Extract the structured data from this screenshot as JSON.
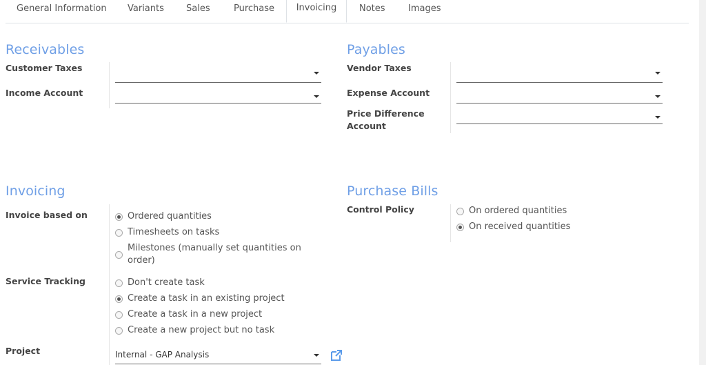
{
  "tabs": [
    {
      "label": "General Information"
    },
    {
      "label": "Variants"
    },
    {
      "label": "Sales"
    },
    {
      "label": "Purchase"
    },
    {
      "label": "Invoicing"
    },
    {
      "label": "Notes"
    },
    {
      "label": "Images"
    }
  ],
  "active_tab": "Invoicing",
  "receivables": {
    "title": "Receivables",
    "customer_taxes_label": "Customer Taxes",
    "income_account_label": "Income Account"
  },
  "payables": {
    "title": "Payables",
    "vendor_taxes_label": "Vendor Taxes",
    "expense_account_label": "Expense Account",
    "price_difference_label_1": "Price Difference",
    "price_difference_label_2": "Account"
  },
  "invoicing": {
    "title": "Invoicing",
    "invoice_based_on_label": "Invoice based on",
    "invoice_options": [
      {
        "label": "Ordered quantities",
        "checked": true
      },
      {
        "label": "Timesheets on tasks",
        "checked": false
      },
      {
        "label_1": "Milestones (manually set quantities on",
        "label_2": "order)",
        "checked": false
      }
    ],
    "service_tracking_label": "Service Tracking",
    "service_options": [
      {
        "label": "Don't create task",
        "checked": false
      },
      {
        "label": "Create a task in an existing project",
        "checked": true
      },
      {
        "label": "Create a task in a new project",
        "checked": false
      },
      {
        "label": "Create a new project but no task",
        "checked": false
      }
    ],
    "project_label": "Project",
    "project_value": "Internal - GAP Analysis"
  },
  "purchase_bills": {
    "title": "Purchase Bills",
    "control_policy_label": "Control Policy",
    "options": [
      {
        "label": "On ordered quantities",
        "checked": false
      },
      {
        "label": "On received quantities",
        "checked": true
      }
    ]
  },
  "colors": {
    "section_title": "#6f9fe6",
    "link_icon": "#5b9bea"
  },
  "icons": {
    "external_link": "external-link-icon",
    "dropdown": "caret-down-icon"
  }
}
